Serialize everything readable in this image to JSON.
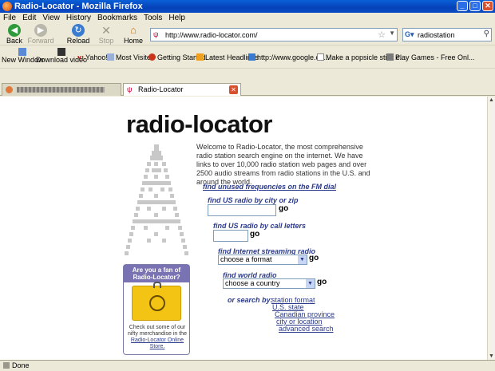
{
  "window": {
    "title": "Radio-Locator - Mozilla Firefox"
  },
  "menu": [
    "File",
    "Edit",
    "View",
    "History",
    "Bookmarks",
    "Tools",
    "Help"
  ],
  "nav": {
    "back": "Back",
    "forward": "Forward",
    "reload": "Reload",
    "stop": "Stop",
    "home": "Home"
  },
  "address": {
    "url": "http://www.radio-locator.com/"
  },
  "search": {
    "value": "radiostation"
  },
  "bookmarks": {
    "new_window": "New Window",
    "download_video": "Download video",
    "yahoo": "Yahoo!",
    "most_visited": "Most Visited",
    "getting_started": "Getting Started",
    "latest_headlines": "Latest Headlines",
    "google": "http://www.google.co...",
    "popsicle": "Make a popsicle stick c...",
    "play_games": "Play Games - Free Onl..."
  },
  "tabs": [
    {
      "label": ""
    },
    {
      "label": "Radio-Locator"
    }
  ],
  "page": {
    "logo": "radio-locator",
    "intro": "Welcome to Radio-Locator, the most comprehensive radio station search engine on the internet. We have links to over 10,000 radio station web pages and over 2500 audio streams from radio stations in the U.S. and around the world.",
    "unused_link": "find unused frequencies on the FM dial",
    "city_label": "find US radio by city or zip",
    "call_label": "find US radio by call letters",
    "stream_label": "find Internet streaming radio",
    "stream_select": "choose a format",
    "world_label": "find world radio",
    "world_select": "choose a country",
    "go": "go",
    "or_search": "or search by:",
    "search_links": [
      "station format",
      "U.S. state",
      "Canadian province",
      "city or location",
      "advanced search"
    ],
    "fan_title": "Are you a fan of Radio-Locator?",
    "fan_text": "Check out some of our nifty merchandise in the",
    "fan_link": "Radio-Locator Online Store."
  },
  "status": {
    "text": "Done"
  },
  "colors": {
    "link": "#2b3a8c",
    "title_bar": "#0a5fd8",
    "fan_header": "#7a73b3",
    "bag": "#f3c414"
  }
}
